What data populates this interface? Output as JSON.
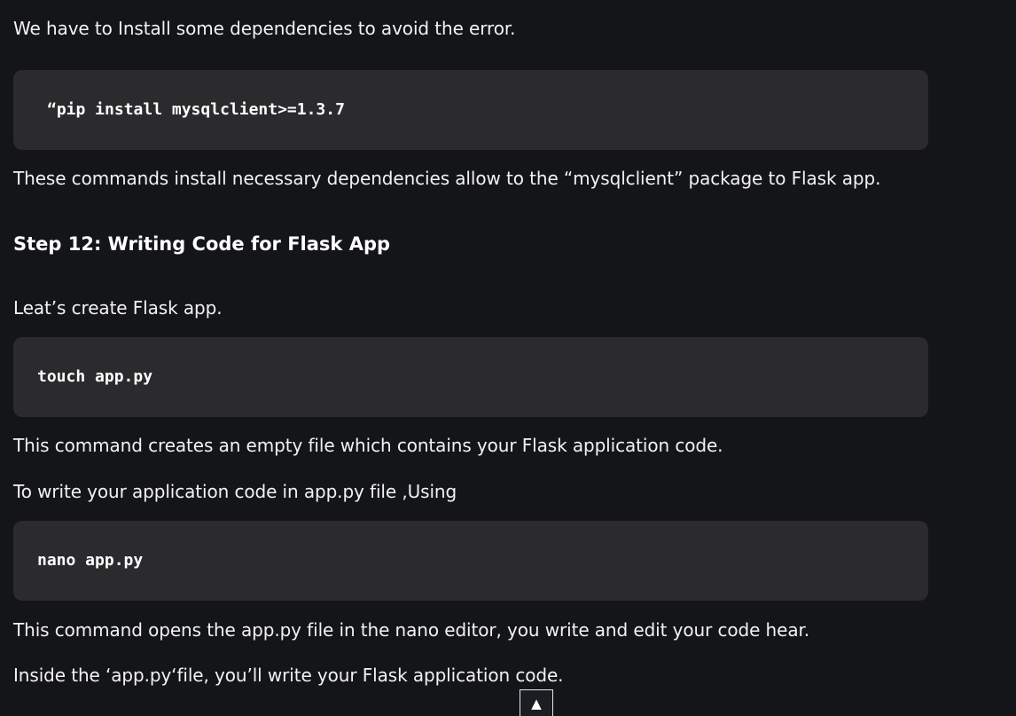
{
  "paragraphs": {
    "p1": "We have to Install some dependencies to avoid the error.",
    "p2": "These commands install necessary dependencies allow to the “mysqlclient” package to Flask app.",
    "p3": "Leat’s create Flask app.",
    "p4": "This command creates an empty file which contains your Flask application code.",
    "p5": "To write your application code in app.py file ,Using",
    "p6": "This command opens the app.py file in the nano editor, you write and edit your code hear.",
    "p7": "Inside the ‘app.py‘file, you’ll write your Flask application code."
  },
  "headings": {
    "step12": "Step 12: Writing Code for Flask App"
  },
  "code_blocks": {
    "pip_install": "“pip install mysqlclient>=1.3.7",
    "touch": "touch app.py",
    "nano": "nano app.py"
  },
  "controls": {
    "scroll_top_icon": "▲"
  },
  "colors": {
    "background": "#141519",
    "code_background": "#2b2b2d",
    "text": "#f2f2f2"
  }
}
